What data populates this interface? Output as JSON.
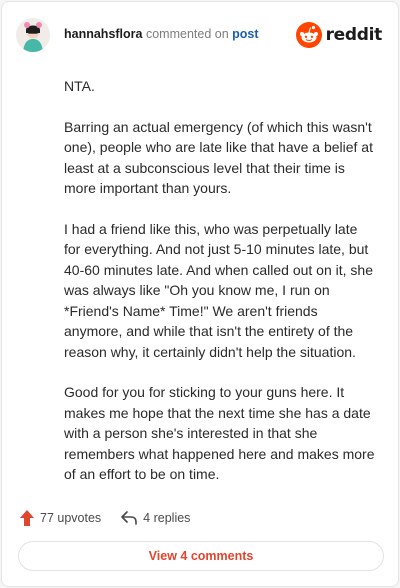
{
  "header": {
    "username": "hannahsflora",
    "action_text": "commented on",
    "post_link": "post",
    "brand": "reddit"
  },
  "comment": {
    "paragraphs": [
      "NTA.",
      "Barring an actual emergency (of which this wasn't one), people who are late like that have a belief at least at a subconscious level that their time is more important than yours.",
      "I had a friend like this, who was perpetually late for everything. And not just 5-10 minutes late, but 40-60 minutes late. And when called out on it, she was always like \"Oh you know me, I run on *Friend's Name* Time!\" We aren't friends anymore, and while that isn't the entirety of the reason why, it certainly didn't help the situation.",
      "Good for you for sticking to your guns here. It makes me hope that the next time she has a date with a person she's interested in that she remembers what happened here and makes more of an effort to be on time."
    ]
  },
  "actions": {
    "upvotes": "77 upvotes",
    "replies": "4 replies",
    "upvote_icon": "upvote-arrow-icon",
    "reply_icon": "reply-arrow-icon"
  },
  "footer": {
    "view_button": "View 4 comments"
  },
  "colors": {
    "reddit_orange": "#ff4500",
    "upvote": "#e2452d",
    "link_blue": "#1a5fb4"
  }
}
